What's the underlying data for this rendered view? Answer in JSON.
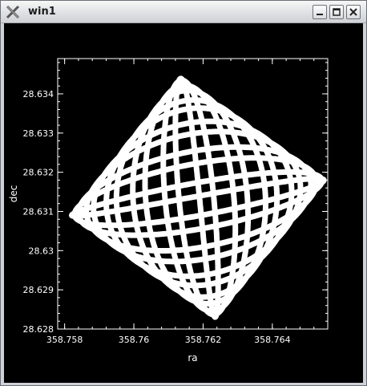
{
  "window": {
    "title": "win1",
    "buttons": {
      "minimize": "minimize-icon",
      "maximize": "maximize-icon",
      "close": "close-icon"
    }
  },
  "colors": {
    "plot_background": "#000000",
    "foreground": "#ffffff",
    "window_chrome": "#cfd2d6"
  },
  "chart_data": {
    "type": "scatter",
    "title": "",
    "xlabel": "ra",
    "ylabel": "dec",
    "xlim": [
      358.7578,
      358.7656
    ],
    "ylim": [
      28.628,
      28.6349
    ],
    "xticks": [
      "358.758",
      "358.76",
      "358.762",
      "358.764"
    ],
    "yticks": [
      "28.628",
      "28.629",
      "28.63",
      "28.631",
      "28.632",
      "28.633",
      "28.634"
    ],
    "grid": false,
    "legend": "none",
    "description_points": {
      "corners": {
        "left": [
          358.7582,
          28.631
        ],
        "top": [
          358.7614,
          28.6344
        ],
        "right": [
          358.7655,
          28.6319
        ],
        "bottom": [
          358.7624,
          28.6283
        ]
      },
      "lissajous": {
        "x_center": 358.76185,
        "y_center": 28.63135,
        "a": 0.00365,
        "b": 0.003,
        "n_u": 12,
        "n_v": 11,
        "phase": 0.5,
        "samples": 3000
      }
    }
  }
}
